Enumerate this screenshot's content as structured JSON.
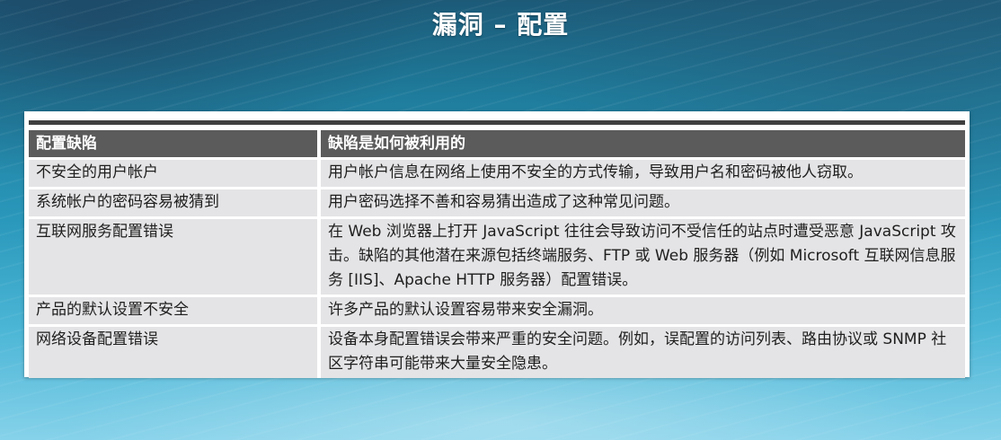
{
  "title": "漏洞 – 配置",
  "table": {
    "headers": [
      "配置缺陷",
      "缺陷是如何被利用的"
    ],
    "rows": [
      [
        "不安全的用户帐户",
        "用户帐户信息在网络上使用不安全的方式传输，导致用户名和密码被他人窃取。"
      ],
      [
        "系统帐户的密码容易被猜到",
        "用户密码选择不善和容易猜出造成了这种常见问题。"
      ],
      [
        "互联网服务配置错误",
        "在 Web 浏览器上打开 JavaScript 往往会导致访问不受信任的站点时遭受恶意 JavaScript 攻击。缺陷的其他潜在来源包括终端服务、FTP 或 Web 服务器（例如 Microsoft 互联网信息服务 [IIS]、Apache HTTP 服务器）配置错误。"
      ],
      [
        "产品的默认设置不安全",
        "许多产品的默认设置容易带来安全漏洞。"
      ],
      [
        "网络设备配置错误",
        "设备本身配置错误会带来严重的安全问题。例如，误配置的访问列表、路由协议或 SNMP 社区字符串可能带来大量安全隐患。"
      ]
    ]
  }
}
